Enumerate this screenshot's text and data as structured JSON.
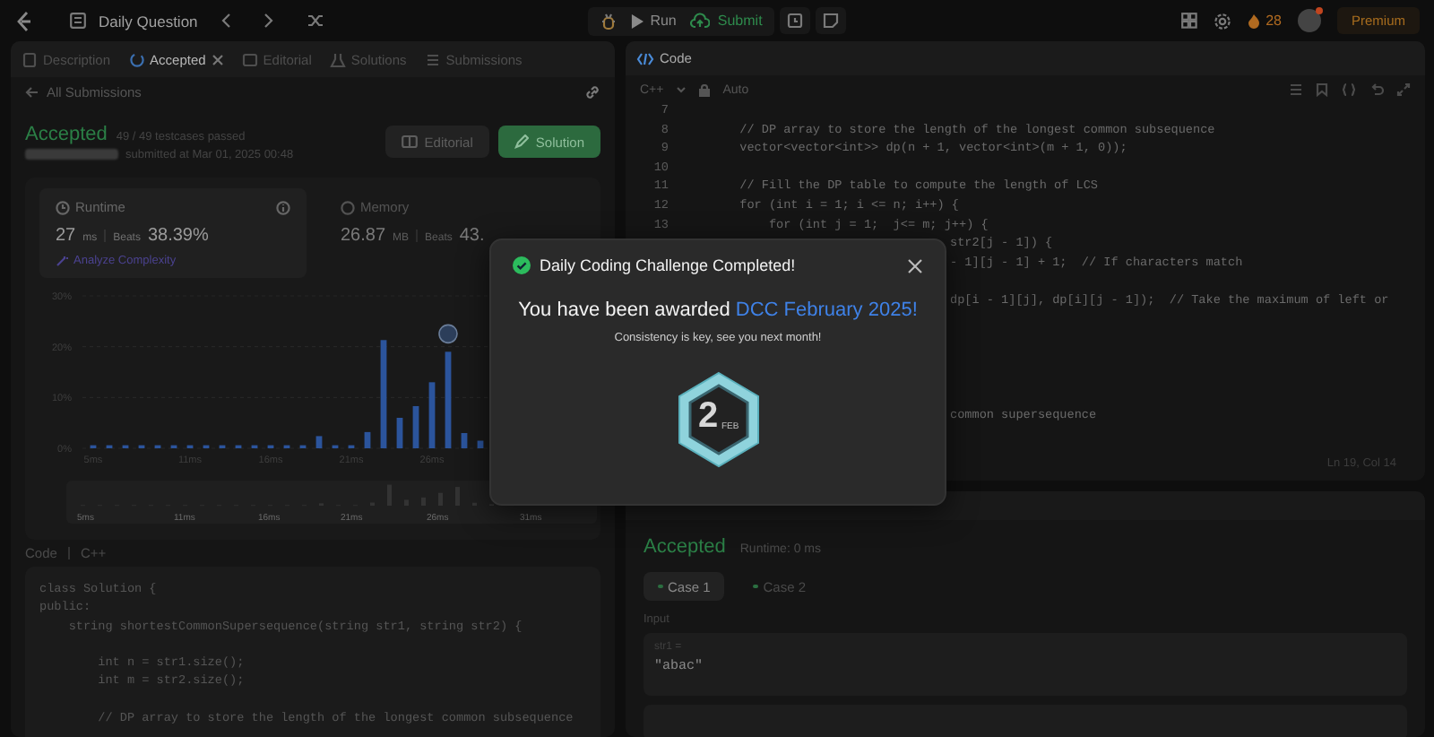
{
  "top_bar": {
    "title": "Daily Question",
    "run": "Run",
    "submit": "Submit",
    "streak": "28",
    "premium": "Premium"
  },
  "left_panel": {
    "tabs": [
      {
        "label": "Description",
        "selected": false,
        "closable": false
      },
      {
        "label": "Accepted",
        "selected": true,
        "closable": true
      },
      {
        "label": "Editorial",
        "selected": false,
        "closable": false
      },
      {
        "label": "Solutions",
        "selected": false,
        "closable": false
      },
      {
        "label": "Submissions",
        "selected": false,
        "closable": false
      }
    ],
    "back_link": "All Submissions",
    "result": {
      "status": "Accepted",
      "testcases": "49 / 49 testcases passed",
      "submitted": "submitted at Mar 01, 2025 00:48"
    },
    "buttons": [
      {
        "label": "Editorial",
        "kind": "secondary"
      },
      {
        "label": "Solution",
        "kind": "primary"
      }
    ],
    "stats": [
      {
        "title": "Runtime",
        "value": "27",
        "unit": "ms",
        "beats_label": "Beats",
        "beats": "38.39%",
        "link": "Analyze Complexity",
        "selected": true
      },
      {
        "title": "Memory",
        "value": "26.87",
        "unit": "MB",
        "beats_label": "Beats",
        "beats": "43.",
        "selected": false
      }
    ],
    "chart_data": {
      "type": "bar",
      "x": [
        5,
        6,
        7,
        8,
        9,
        10,
        11,
        12,
        13,
        14,
        15,
        16,
        17,
        18,
        19,
        20,
        21,
        22,
        23,
        24,
        25,
        26,
        27,
        28,
        29
      ],
      "values": [
        0.6,
        0.6,
        0.6,
        0.6,
        0.6,
        0.6,
        0.6,
        0.6,
        0.6,
        0.6,
        0.6,
        0.6,
        0.6,
        0.6,
        2.4,
        0.6,
        0.6,
        3.2,
        21.3,
        6,
        8.3,
        13,
        19,
        3,
        1.5
      ],
      "xlim": [
        4.5,
        29.5
      ],
      "ylim": [
        0,
        30
      ],
      "yticks": [
        {
          "value": 0,
          "label": "0%"
        },
        {
          "value": 10,
          "label": "10%"
        },
        {
          "value": 20,
          "label": "20%"
        },
        {
          "value": 30,
          "label": "30%"
        }
      ],
      "xticks": [
        {
          "value": 5,
          "label": "5ms"
        },
        {
          "value": 11,
          "label": "11ms"
        },
        {
          "value": 16,
          "label": "16ms"
        },
        {
          "value": 21,
          "label": "21ms"
        },
        {
          "value": 26,
          "label": "26ms"
        }
      ]
    },
    "range_labels": [
      "5ms",
      "11ms",
      "16ms",
      "21ms",
      "26ms",
      "31ms"
    ],
    "code_header": {
      "title": "Code",
      "language": "C++"
    },
    "code": [
      {
        "kind": "line",
        "code": "class Solution {"
      },
      {
        "kind": "line",
        "code": "public:"
      },
      {
        "kind": "line",
        "code": "    string shortestCommonSupersequence(string str1, string str2) {"
      },
      {
        "kind": "blank"
      },
      {
        "kind": "line",
        "code": "        int n = str1.size();"
      },
      {
        "kind": "line",
        "code": "        int m = str2.size();"
      },
      {
        "kind": "blank"
      },
      {
        "kind": "line",
        "code": "        // DP array to store the length of the longest common subsequence"
      }
    ]
  },
  "editor": {
    "title": "Code",
    "language": "C++",
    "mode": "Auto",
    "lines": [
      {
        "kind": "full",
        "number": "7"
      },
      {
        "kind": "full",
        "number": "8",
        "code": "        // DP array to store the length of the longest common subsequence"
      },
      {
        "kind": "full",
        "number": "9",
        "code": "        vector<vector<int>> dp(n + 1, vector<int>(m + 1, 0));"
      },
      {
        "kind": "full",
        "number": "10"
      },
      {
        "kind": "full",
        "number": "11",
        "code": "        // Fill the DP table to compute the length of LCS"
      },
      {
        "kind": "full",
        "number": "12",
        "code": "        for (int i = 1; i <= n; i++) {"
      },
      {
        "kind": "full",
        "number": "13",
        "code": "            for (int j = 1;  j<= m; j++) {"
      },
      {
        "kind": "partial",
        "code": "str2[j - 1]) {"
      },
      {
        "kind": "partial",
        "code": "- 1][j - 1] + 1;  // If characters match"
      },
      {
        "kind": "partial"
      },
      {
        "kind": "partial",
        "code": "dp[i - 1][j], dp[i][j - 1]);  // Take the maximum of left or"
      },
      {
        "kind": "partial"
      },
      {
        "kind": "partial"
      },
      {
        "kind": "partial"
      },
      {
        "kind": "partial"
      },
      {
        "kind": "partial"
      },
      {
        "kind": "partial",
        "code": "common supersequence"
      }
    ],
    "cursor": "Ln 19, Col 14"
  },
  "result_panel": {
    "status": "Accepted",
    "runtime": "Runtime: 0 ms",
    "cases": [
      {
        "label": "Case 1",
        "selected": true
      },
      {
        "label": "Case 2",
        "selected": false
      }
    ],
    "input_label": "Input",
    "inputs": [
      {
        "name": "str1 =",
        "value": "\"abac\""
      }
    ]
  },
  "modal": {
    "title": "Daily Coding Challenge Completed!",
    "message": "You have been awarded",
    "award": "DCC February 2025!",
    "subtitle": "Consistency is key, see you next month!",
    "badge": {
      "day": "2",
      "month": "FEB"
    }
  }
}
